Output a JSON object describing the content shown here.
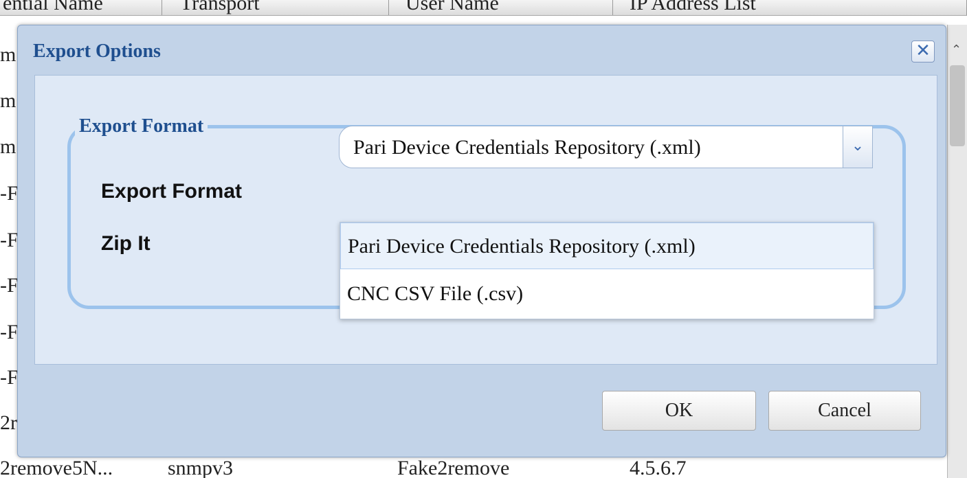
{
  "background": {
    "columns": [
      {
        "label": "ential Name"
      },
      {
        "label": "Transport"
      },
      {
        "label": "User Name"
      },
      {
        "label": "IP Address List"
      }
    ],
    "row_fragments": [
      "m",
      "m",
      "m",
      "-F",
      "-F",
      "-F",
      "-F",
      "-F",
      "2r"
    ],
    "bottom_row": [
      "2remove5N...",
      "snmpv3",
      "Fake2remove",
      "4.5.6.7"
    ],
    "scroll_up_icon": "chevron-up-icon"
  },
  "dialog": {
    "title": "Export Options",
    "close_icon": "close-icon",
    "fieldset_legend": "Export Format",
    "fields": {
      "export_format_label": "Export Format",
      "zip_it_label": "Zip It"
    },
    "select": {
      "value": "Pari Device Credentials Repository (.xml)",
      "arrow_icon": "chevron-down-icon",
      "options": [
        "Pari Device Credentials Repository (.xml)",
        "CNC CSV File (.csv)"
      ]
    },
    "buttons": {
      "ok": "OK",
      "cancel": "Cancel"
    }
  },
  "colors": {
    "dialog_bg": "#c2d3e8",
    "title_text": "#1f4f8f",
    "fieldset_border": "#9cc3ec",
    "selected_option_bg": "#eaf2fb"
  }
}
